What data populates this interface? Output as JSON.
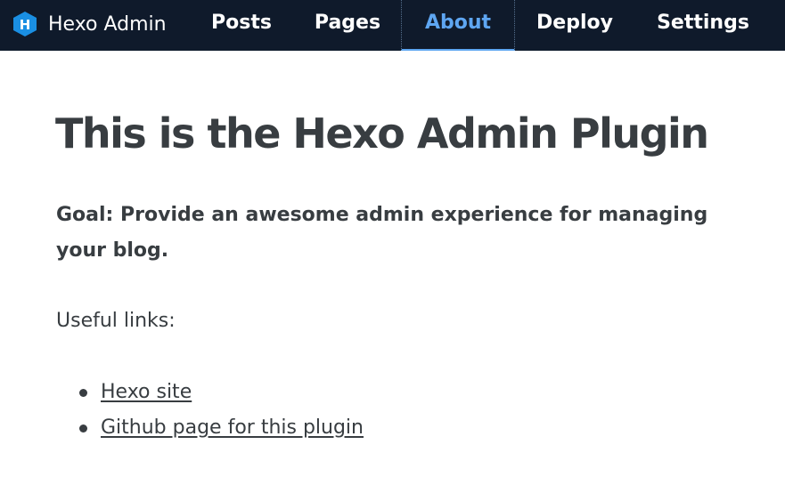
{
  "app": {
    "name": "Hexo Admin",
    "logo_letter": "H",
    "logo_color": "#1a8fe3"
  },
  "nav": {
    "items": [
      {
        "label": "Posts",
        "active": false
      },
      {
        "label": "Pages",
        "active": false
      },
      {
        "label": "About",
        "active": true
      },
      {
        "label": "Deploy",
        "active": false
      },
      {
        "label": "Settings",
        "active": false
      }
    ]
  },
  "main": {
    "title": "This is the Hexo Admin Plugin",
    "goal": "Goal: Provide an awesome admin experience for managing your blog.",
    "useful_links_label": "Useful links:",
    "links": [
      {
        "label": "Hexo site"
      },
      {
        "label": "Github page for this plugin"
      }
    ]
  },
  "colors": {
    "navbar_bg": "#0f1a2b",
    "active_nav": "#5ea6f2",
    "text": "#383d41"
  }
}
